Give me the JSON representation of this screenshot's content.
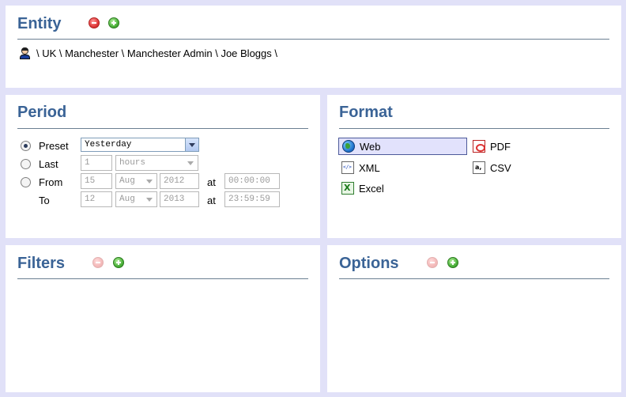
{
  "entity": {
    "title": "Entity",
    "path": [
      "\\ UK \\",
      "Manchester \\",
      "Manchester Admin \\",
      "Joe Bloggs \\"
    ],
    "user_icon": "user-icon"
  },
  "period": {
    "title": "Period",
    "preset": {
      "label": "Preset",
      "value": "Yesterday",
      "selected": true
    },
    "last": {
      "label": "Last",
      "count": "1",
      "unit": "hours"
    },
    "from": {
      "label": "From",
      "day": "15",
      "month": "Aug",
      "year": "2012",
      "at": "at",
      "time": "00:00:00"
    },
    "to": {
      "label": "To",
      "day": "12",
      "month": "Aug",
      "year": "2013",
      "at": "at",
      "time": "23:59:59"
    }
  },
  "format": {
    "title": "Format",
    "items": [
      {
        "label": "Web",
        "icon": "globe-icon",
        "selected": true
      },
      {
        "label": "PDF",
        "icon": "pdf-icon",
        "selected": false
      },
      {
        "label": "XML",
        "icon": "xml-icon",
        "selected": false
      },
      {
        "label": "CSV",
        "icon": "csv-icon",
        "selected": false
      },
      {
        "label": "Excel",
        "icon": "excel-icon",
        "selected": false
      }
    ]
  },
  "filters": {
    "title": "Filters"
  },
  "options": {
    "title": "Options"
  },
  "colors": {
    "heading": "#3a6396",
    "background": "#e1e1f8",
    "selected_bg": "#e2e2fc"
  }
}
